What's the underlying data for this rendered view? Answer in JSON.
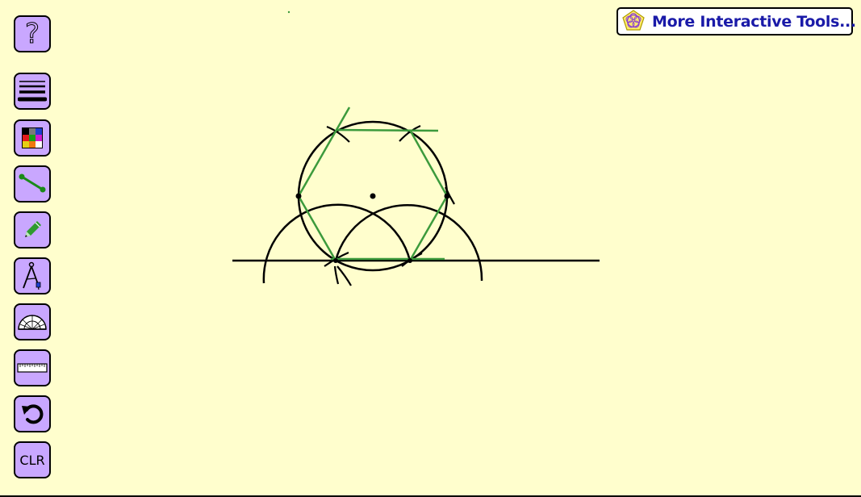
{
  "toolbar": {
    "help_label": "?",
    "clear_label": "CLR",
    "buttons": [
      {
        "name": "help-button",
        "icon": "question-mark-icon"
      },
      {
        "name": "line-width-button",
        "icon": "line-weights-icon"
      },
      {
        "name": "color-palette-button",
        "icon": "color-grid-icon"
      },
      {
        "name": "line-segment-tool-button",
        "icon": "segment-icon"
      },
      {
        "name": "pencil-tool-button",
        "icon": "pencil-icon"
      },
      {
        "name": "compass-tool-button",
        "icon": "compass-icon"
      },
      {
        "name": "protractor-tool-button",
        "icon": "protractor-icon"
      },
      {
        "name": "ruler-tool-button",
        "icon": "ruler-icon"
      },
      {
        "name": "undo-button",
        "icon": "undo-icon"
      },
      {
        "name": "clear-button",
        "icon": "clr-text"
      }
    ]
  },
  "more_tools": {
    "label": "More Interactive Tools...",
    "icon": "pentagon-flower-logo-icon"
  },
  "colors": {
    "background": "#fffecd",
    "button_fill": "#c9a7ff",
    "construction_stroke": "#000000",
    "hexagon_stroke": "#3c9a3c",
    "link_text": "#1a1aa8"
  }
}
